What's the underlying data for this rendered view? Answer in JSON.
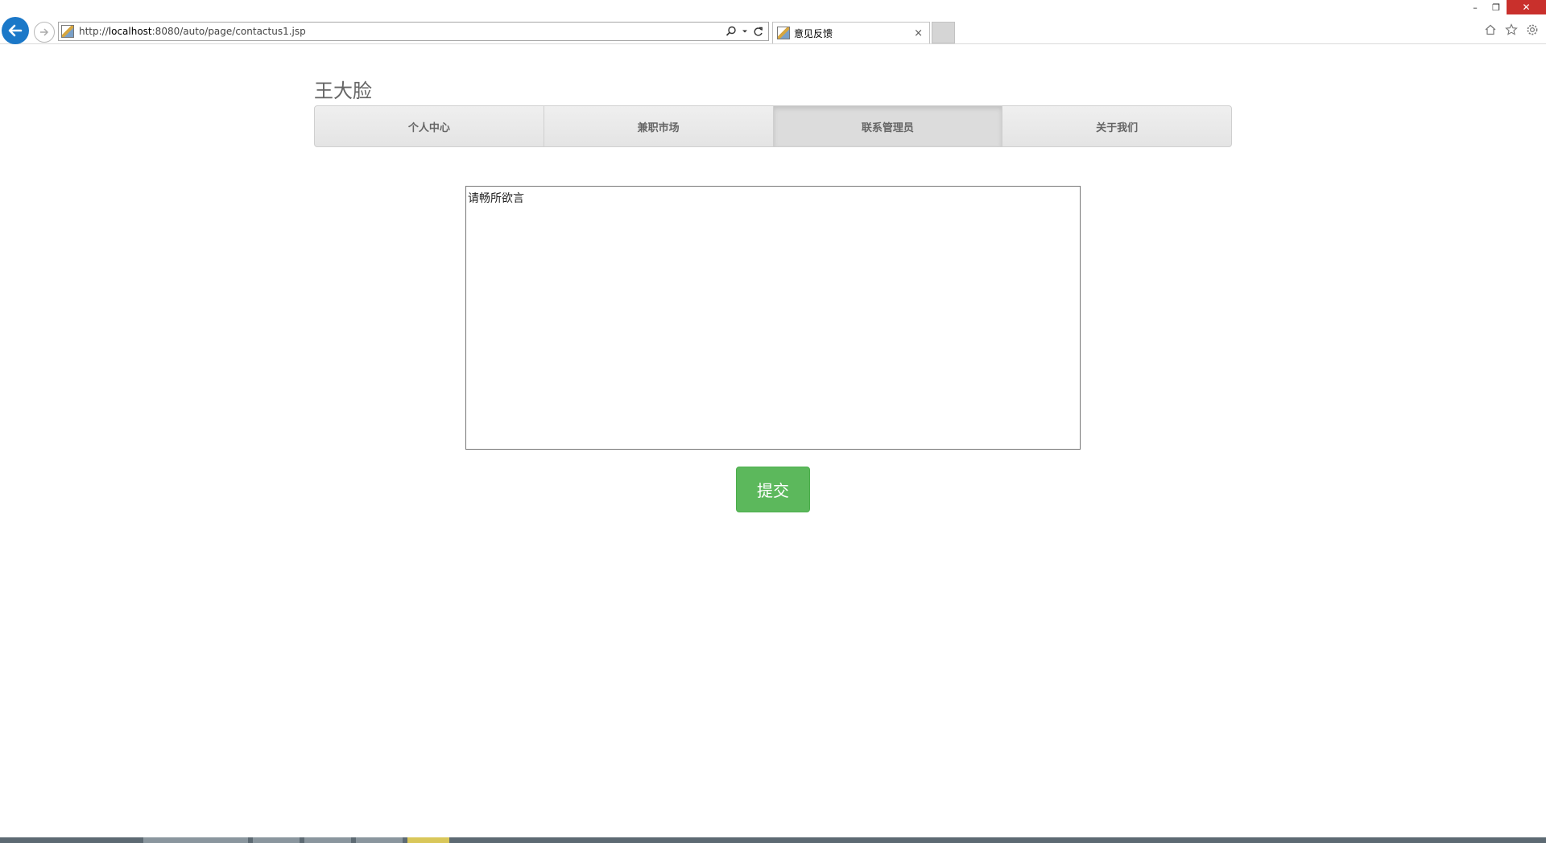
{
  "browser": {
    "url_scheme": "http://",
    "url_host": "localhost",
    "url_path": ":8080/auto/page/contactus1.jsp",
    "tab_title": "意见反馈",
    "tab_close": "×",
    "win_minimize": "–",
    "win_restore": "❐",
    "win_close": "✕"
  },
  "site": {
    "title": "王大脸"
  },
  "nav": {
    "items": [
      {
        "label": "个人中心"
      },
      {
        "label": "兼职市场"
      },
      {
        "label": "联系管理员",
        "active": true
      },
      {
        "label": "关于我们"
      }
    ]
  },
  "feedback": {
    "text": "请畅所欲言"
  },
  "submit": {
    "label": "提交"
  },
  "colors": {
    "accent_green": "#5cb85c",
    "browser_blue": "#1b78c8",
    "close_red": "#c9302c"
  }
}
